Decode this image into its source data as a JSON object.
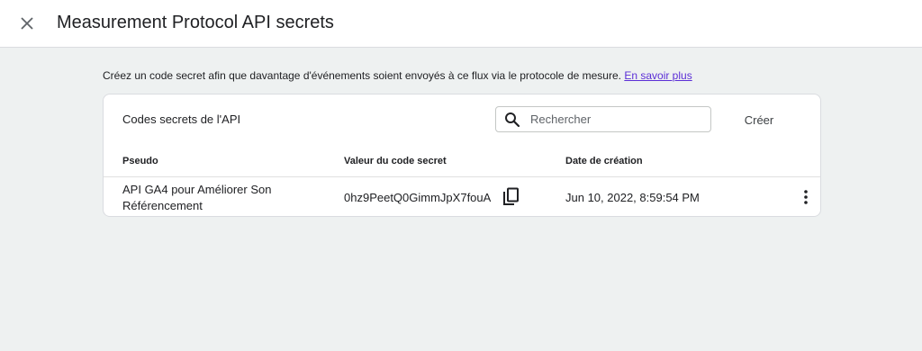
{
  "header": {
    "title": "Measurement Protocol API secrets",
    "close_icon": "close-icon"
  },
  "intro": {
    "text": "Créez un code secret afin que davantage d'événements soient envoyés à ce flux via le protocole de mesure.",
    "link_label": "En savoir plus"
  },
  "card": {
    "title": "Codes secrets de l'API",
    "search": {
      "placeholder": "Rechercher",
      "value": "",
      "icon": "search-icon"
    },
    "create_label": "Créer",
    "columns": [
      "Pseudo",
      "Valeur du code secret",
      "Date de création"
    ],
    "rows": [
      {
        "name": "API GA4 pour Améliorer Son Référencement",
        "secret": "0hz9PeetQ0GimmJpX7fouA",
        "created": "Jun 10, 2022, 8:59:54 PM"
      }
    ]
  },
  "colors": {
    "background": "#eef1f1",
    "link": "#5b2ed6",
    "text": "#202124"
  }
}
